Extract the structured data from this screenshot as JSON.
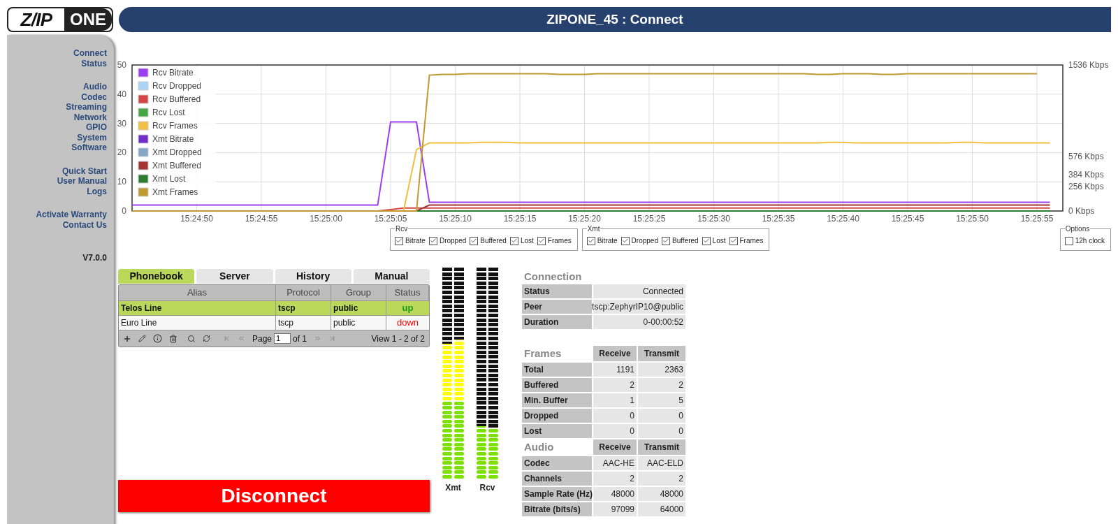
{
  "logo": {
    "left": "Z/IP",
    "right": "ONE"
  },
  "title": "ZIPONE_45 : Connect",
  "sidebar": {
    "groups": [
      {
        "items": [
          "Connect",
          "Status"
        ]
      },
      {
        "items": [
          "Audio",
          "Codec",
          "Streaming",
          "Network",
          "GPIO",
          "System",
          "Software"
        ]
      },
      {
        "items": [
          "Quick Start",
          "User Manual",
          "Logs"
        ]
      },
      {
        "items": [
          "Activate Warranty",
          "Contact Us"
        ]
      }
    ],
    "version": "V7.0.0"
  },
  "chart": {
    "chart_data": {
      "type": "line",
      "categories": [
        null,
        null,
        null,
        null,
        null,
        "15:24:50",
        null,
        null,
        null,
        null,
        "15:24:55",
        null,
        null,
        null,
        null,
        "15:25:00",
        null,
        null,
        null,
        null,
        "15:25:05",
        null,
        null,
        null,
        null,
        "15:25:10",
        null,
        null,
        null,
        null,
        "15:25:15",
        null,
        null,
        null,
        null,
        "15:25:20",
        null,
        null,
        null,
        null,
        "15:25:25",
        null,
        null,
        null,
        null,
        "15:25:30",
        null,
        null,
        null,
        null,
        "15:25:35",
        null,
        null,
        null,
        null,
        "15:25:40",
        null,
        null,
        null,
        null,
        "15:25:45",
        null,
        null,
        null,
        null,
        "15:25:50",
        null,
        null,
        null,
        null,
        "15:25:55",
        null,
        null
      ],
      "ylim": [
        0,
        50
      ],
      "yticks": [
        0,
        10,
        20,
        30,
        40,
        50
      ],
      "grid": true,
      "legend": true,
      "series": [
        {
          "name": "Rcv Bitrate",
          "color": "#9b40f0",
          "values": [
            2,
            2,
            2,
            2,
            2,
            2,
            2,
            2,
            2,
            2,
            2,
            2,
            2,
            2,
            2,
            2,
            2,
            2,
            2,
            2,
            30.5,
            30.5,
            30.5,
            3,
            3,
            3,
            3,
            3,
            3,
            3,
            3,
            3,
            3,
            3,
            3,
            3,
            3,
            3,
            3,
            3,
            3,
            3,
            3,
            3,
            3,
            3,
            3,
            3,
            3,
            3,
            3,
            3,
            3,
            3,
            3,
            3,
            3,
            3,
            3,
            3,
            3,
            3,
            3,
            3,
            3,
            3,
            3,
            3,
            3,
            3,
            3,
            3,
            null
          ]
        },
        {
          "name": "Rcv Dropped",
          "color": "#aad4f5",
          "values": [
            null,
            null,
            null,
            null,
            null,
            null,
            null,
            null,
            null,
            null,
            null,
            null,
            null,
            null,
            null,
            null,
            null,
            null,
            null,
            null,
            null,
            null,
            null,
            null,
            null,
            null,
            null,
            null,
            null,
            null,
            null,
            null,
            null,
            null,
            null,
            null,
            null,
            null,
            null,
            null,
            null,
            null,
            null,
            null,
            null,
            null,
            null,
            null,
            null,
            null,
            null,
            null,
            null,
            null,
            null,
            null,
            null,
            null,
            null,
            null,
            null,
            null,
            null,
            null,
            null,
            null,
            null,
            null,
            null,
            null,
            null,
            null,
            null
          ]
        },
        {
          "name": "Rcv Buffered",
          "color": "#d64545",
          "values": [
            null,
            null,
            null,
            null,
            null,
            null,
            null,
            null,
            null,
            null,
            null,
            null,
            null,
            null,
            null,
            null,
            null,
            null,
            null,
            0,
            0.5,
            1,
            1,
            1,
            1,
            1,
            1,
            1,
            1,
            1,
            1,
            1,
            1,
            1,
            1,
            1,
            1,
            1,
            1,
            1,
            1,
            1,
            1,
            1,
            1,
            1,
            1,
            1,
            1,
            1,
            1,
            1,
            1,
            1,
            1,
            1,
            1,
            1,
            1,
            1,
            1,
            1,
            1,
            1,
            1,
            1,
            1,
            1,
            1,
            1,
            1,
            1,
            null
          ]
        },
        {
          "name": "Rcv Lost",
          "color": "#45a845",
          "values": [
            null,
            null,
            null,
            null,
            null,
            null,
            null,
            null,
            null,
            null,
            null,
            null,
            null,
            null,
            null,
            null,
            null,
            null,
            null,
            null,
            null,
            null,
            null,
            null,
            null,
            null,
            null,
            null,
            null,
            null,
            null,
            null,
            null,
            null,
            null,
            null,
            null,
            null,
            null,
            null,
            null,
            null,
            null,
            null,
            null,
            null,
            null,
            null,
            null,
            null,
            null,
            null,
            null,
            null,
            null,
            null,
            null,
            null,
            null,
            null,
            null,
            null,
            null,
            null,
            null,
            null,
            null,
            null,
            null,
            null,
            null,
            null,
            null
          ]
        },
        {
          "name": "Rcv Frames",
          "color": "#f0c040",
          "values": [
            null,
            null,
            null,
            null,
            null,
            null,
            null,
            null,
            null,
            null,
            null,
            null,
            null,
            null,
            null,
            null,
            null,
            null,
            null,
            null,
            null,
            0,
            21,
            23.3,
            23.3,
            23.3,
            23.3,
            23.5,
            23.5,
            23.5,
            23.3,
            23.3,
            23.3,
            23.3,
            23.3,
            23.3,
            23.3,
            23.3,
            23.3,
            23.3,
            23.3,
            23.3,
            23.3,
            23.3,
            23.3,
            23.3,
            23.3,
            23.3,
            23.3,
            23.3,
            23.3,
            23.3,
            23.3,
            23.3,
            23.5,
            23.5,
            23.3,
            23.3,
            23.3,
            23.3,
            23.3,
            23.3,
            23.3,
            23.3,
            23.5,
            23.5,
            23.3,
            23.3,
            23.3,
            23.3,
            23.3,
            23.3,
            null
          ]
        },
        {
          "name": "Xmt Bitrate",
          "color": "#7030c8",
          "values": [
            null,
            null,
            null,
            null,
            null,
            null,
            null,
            null,
            null,
            null,
            null,
            null,
            null,
            null,
            null,
            null,
            null,
            null,
            null,
            null,
            null,
            null,
            null,
            null,
            null,
            null,
            null,
            null,
            null,
            null,
            null,
            null,
            null,
            null,
            null,
            null,
            null,
            null,
            null,
            null,
            null,
            null,
            null,
            null,
            null,
            null,
            null,
            null,
            null,
            null,
            null,
            null,
            null,
            null,
            null,
            null,
            null,
            null,
            null,
            null,
            null,
            null,
            null,
            null,
            null,
            null,
            null,
            null,
            null,
            null,
            null,
            null,
            null
          ]
        },
        {
          "name": "Xmt Dropped",
          "color": "#85a8c8",
          "values": [
            null,
            null,
            null,
            null,
            null,
            null,
            null,
            null,
            null,
            null,
            null,
            null,
            null,
            null,
            null,
            null,
            null,
            null,
            null,
            null,
            null,
            null,
            null,
            null,
            null,
            null,
            null,
            null,
            null,
            null,
            null,
            null,
            null,
            null,
            null,
            null,
            null,
            null,
            null,
            null,
            null,
            null,
            null,
            null,
            null,
            null,
            null,
            null,
            null,
            null,
            null,
            null,
            null,
            null,
            null,
            null,
            null,
            null,
            null,
            null,
            null,
            null,
            null,
            null,
            null,
            null,
            null,
            null,
            null,
            null,
            null,
            null,
            null
          ]
        },
        {
          "name": "Xmt Buffered",
          "color": "#a33535",
          "values": [
            null,
            null,
            null,
            null,
            null,
            null,
            null,
            null,
            null,
            null,
            null,
            null,
            null,
            null,
            null,
            null,
            null,
            null,
            null,
            null,
            null,
            null,
            0,
            2,
            2,
            2,
            2,
            2,
            2,
            2,
            2,
            2,
            2,
            2,
            2,
            2,
            2,
            2,
            2,
            2,
            2,
            2,
            2,
            2,
            2,
            2,
            2,
            2,
            2,
            2,
            2,
            2,
            2,
            2,
            2,
            2,
            2,
            2,
            2,
            2,
            2,
            2,
            2,
            2,
            2,
            2,
            2,
            2,
            2,
            2,
            2,
            2,
            null
          ]
        },
        {
          "name": "Xmt Lost",
          "color": "#2e7d32",
          "values": [
            null,
            null,
            null,
            null,
            null,
            null,
            null,
            null,
            null,
            null,
            null,
            null,
            null,
            null,
            null,
            null,
            null,
            null,
            null,
            null,
            null,
            null,
            0,
            0,
            0,
            0,
            0,
            0,
            0,
            0,
            0,
            0,
            0,
            0,
            0,
            0,
            0,
            0,
            0,
            0,
            0,
            0,
            0,
            0,
            0,
            0,
            0,
            0,
            0,
            0,
            0,
            0,
            0,
            0,
            0,
            0,
            0,
            0,
            0,
            0,
            0,
            0,
            0,
            0,
            0,
            0,
            0,
            0,
            0,
            0,
            0,
            0,
            null
          ]
        },
        {
          "name": "Xmt Frames",
          "color": "#c09a30",
          "values": [
            0,
            0,
            0,
            0,
            0,
            0,
            0,
            0,
            0,
            0,
            0,
            0,
            0,
            0,
            0,
            0,
            0,
            0,
            0,
            0,
            0,
            0,
            0,
            46.5,
            46.8,
            46.8,
            47,
            47,
            47,
            47,
            47,
            47,
            47,
            46.8,
            46.8,
            46.8,
            47,
            47,
            47,
            47,
            47,
            47,
            47,
            47,
            47,
            47,
            47,
            47,
            47,
            47,
            47,
            47,
            47,
            46.8,
            46.8,
            47,
            47,
            47,
            46.8,
            46.8,
            47,
            47,
            47,
            47,
            47,
            47,
            47,
            47,
            47,
            47,
            47,
            null,
            null
          ]
        }
      ]
    },
    "right_axis": [
      "1536 Kbps",
      "576 Kbps",
      "384 Kbps",
      "256 Kbps",
      "0 Kbps"
    ]
  },
  "chart_filters": [
    {
      "legend": "Rcv",
      "options": [
        {
          "label": "Bitrate",
          "checked": true
        },
        {
          "label": "Dropped",
          "checked": true
        },
        {
          "label": "Buffered",
          "checked": true
        },
        {
          "label": "Lost",
          "checked": true
        },
        {
          "label": "Frames",
          "checked": true
        }
      ]
    },
    {
      "legend": "Xmt",
      "options": [
        {
          "label": "Bitrate",
          "checked": true
        },
        {
          "label": "Dropped",
          "checked": true
        },
        {
          "label": "Buffered",
          "checked": true
        },
        {
          "label": "Lost",
          "checked": true
        },
        {
          "label": "Frames",
          "checked": true
        }
      ]
    }
  ],
  "options": {
    "legend": "Options",
    "items": [
      {
        "label": "12h clock",
        "checked": false
      }
    ]
  },
  "phonebook": {
    "tabs": [
      {
        "label": "Phonebook",
        "selected": true
      },
      {
        "label": "Server",
        "selected": false
      },
      {
        "label": "History",
        "selected": false
      },
      {
        "label": "Manual",
        "selected": false
      }
    ],
    "columns": [
      "Alias",
      "Protocol",
      "Group",
      "Status"
    ],
    "rows": [
      {
        "alias": "Telos Line",
        "protocol": "tscp",
        "group": "public",
        "status": "up",
        "up": true,
        "selected": true
      },
      {
        "alias": "Euro Line",
        "protocol": "tscp",
        "group": "public",
        "status": "down",
        "up": false,
        "selected": false
      }
    ],
    "pager": {
      "page_label": "Page",
      "page": "1",
      "of": "of 1",
      "view": "View 1 - 2 of 2",
      "nav_disabled": true
    }
  },
  "disconnect": "Disconnect",
  "meters": [
    {
      "label": "Xmt",
      "channels": [
        {
          "level": 0.64
        },
        {
          "level": 0.66
        }
      ]
    },
    {
      "label": "Rcv",
      "channels": [
        {
          "level": 0.25
        },
        {
          "level": 0.24
        }
      ]
    }
  ],
  "connection": {
    "title": "Connection",
    "rows": [
      {
        "label": "Status",
        "value": "Connected"
      },
      {
        "label": "Peer",
        "value": "tscp:ZephyrIP10@public"
      },
      {
        "label": "Duration",
        "value": "0-00:00:52"
      }
    ]
  },
  "frames": {
    "title": "Frames",
    "columns": [
      "Receive",
      "Transmit"
    ],
    "rows": [
      {
        "label": "Total",
        "receive": "1191",
        "transmit": "2363"
      },
      {
        "label": "Buffered",
        "receive": "2",
        "transmit": "2"
      },
      {
        "label": "Min. Buffer",
        "receive": "1",
        "transmit": "5"
      },
      {
        "label": "Dropped",
        "receive": "0",
        "transmit": "0"
      },
      {
        "label": "Lost",
        "receive": "0",
        "transmit": "0"
      }
    ]
  },
  "audio": {
    "title": "Audio",
    "columns": [
      "Receive",
      "Transmit"
    ],
    "rows": [
      {
        "label": "Codec",
        "receive": "AAC-HE",
        "transmit": "AAC-ELD"
      },
      {
        "label": "Channels",
        "receive": "2",
        "transmit": "2"
      },
      {
        "label": "Sample Rate (Hz)",
        "receive": "48000",
        "transmit": "48000"
      },
      {
        "label": "Bitrate (bits/s)",
        "receive": "97099",
        "transmit": "64000"
      }
    ]
  }
}
